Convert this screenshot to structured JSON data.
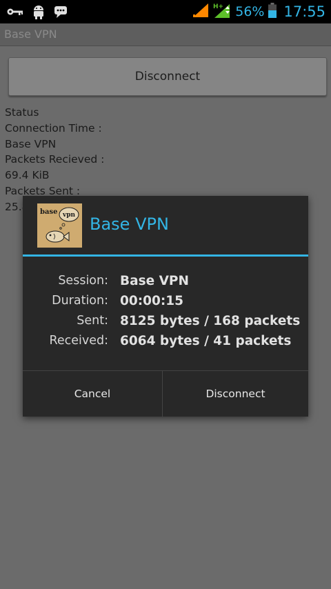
{
  "status_bar": {
    "icons": [
      "key-icon",
      "android-debug-icon",
      "chat-icon"
    ],
    "network_type": "H+",
    "battery_percent": "56%",
    "clock": "17:55",
    "accent_color": "#33b5e5"
  },
  "app": {
    "title": "Base VPN"
  },
  "main": {
    "disconnect_label": "Disconnect",
    "status_lines": [
      "Status",
      "Connection Time :",
      "Base VPN",
      "Packets Recieved :",
      "69.4 KiB",
      "Packets Sent :",
      "25.8"
    ]
  },
  "dialog": {
    "logo_text": "base vpn",
    "title": "Base VPN",
    "rows": [
      {
        "label": "Session:",
        "value": "Base VPN"
      },
      {
        "label": "Duration:",
        "value": "00:00:15"
      },
      {
        "label": "Sent:",
        "value": "8125 bytes / 168 packets"
      },
      {
        "label": "Received:",
        "value": "6064 bytes / 41 packets"
      }
    ],
    "cancel_label": "Cancel",
    "disconnect_label": "Disconnect"
  }
}
